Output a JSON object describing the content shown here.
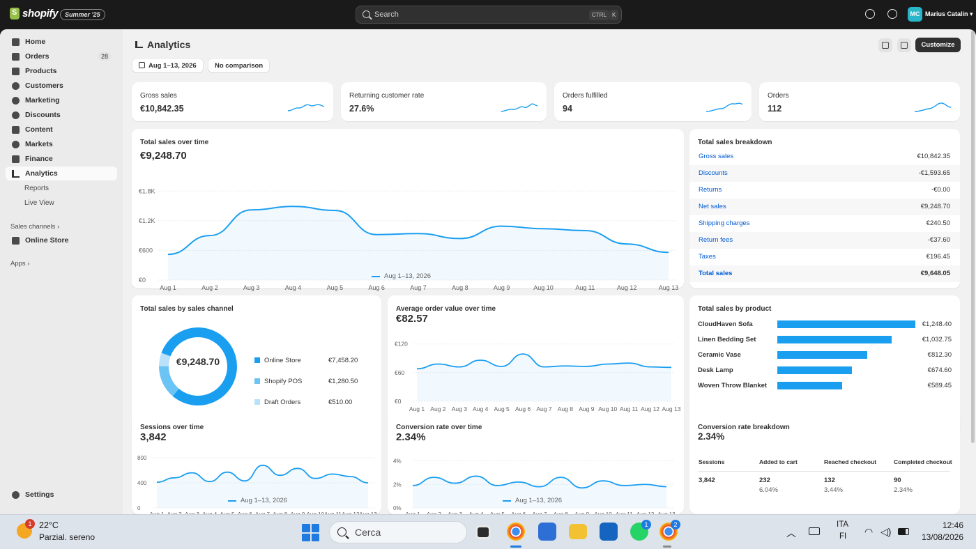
{
  "topbar": {
    "brand": "shopify",
    "edition": "Summer '25",
    "search_placeholder": "Search",
    "shortcut_ctrl": "CTRL",
    "shortcut_key": "K",
    "avatar_initials": "MC",
    "user_name": "Marius Catalin"
  },
  "sidebar": {
    "items": [
      {
        "label": "Home",
        "icon": "home-icon"
      },
      {
        "label": "Orders",
        "icon": "orders-icon",
        "count": "28"
      },
      {
        "label": "Products",
        "icon": "tag-icon"
      },
      {
        "label": "Customers",
        "icon": "person-icon"
      },
      {
        "label": "Marketing",
        "icon": "target-icon"
      },
      {
        "label": "Discounts",
        "icon": "discount-icon"
      },
      {
        "label": "Content",
        "icon": "content-icon"
      },
      {
        "label": "Markets",
        "icon": "globe-icon"
      },
      {
        "label": "Finance",
        "icon": "bank-icon"
      },
      {
        "label": "Analytics",
        "icon": "bar-chart-icon"
      }
    ],
    "sub_items": [
      "Reports",
      "Live View"
    ],
    "sales_channels": "Sales channels",
    "online_store": "Online Store",
    "apps": "Apps",
    "settings": "Settings"
  },
  "header": {
    "title": "Analytics",
    "date_range": "Aug 1–13, 2026",
    "comparison": "No comparison",
    "customize": "Customize"
  },
  "kpis": [
    {
      "label": "Gross sales",
      "value": "€10,842.35"
    },
    {
      "label": "Returning customer rate",
      "value": "27.6%"
    },
    {
      "label": "Orders fulfilled",
      "value": "94"
    },
    {
      "label": "Orders",
      "value": "112"
    }
  ],
  "days": [
    "Aug 1",
    "Aug 2",
    "Aug 3",
    "Aug 4",
    "Aug 5",
    "Aug 6",
    "Aug 7",
    "Aug 8",
    "Aug 9",
    "Aug 10",
    "Aug 11",
    "Aug 12",
    "Aug 13"
  ],
  "legend_label": "Aug 1–13, 2026",
  "total_sales": {
    "title": "Total sales over time",
    "value": "€9,248.70",
    "yticks": [
      "€1.8K",
      "€1.2K",
      "€600",
      "€0"
    ]
  },
  "breakdown": {
    "title": "Total sales breakdown",
    "rows": [
      {
        "label": "Gross sales",
        "value": "€10,842.35"
      },
      {
        "label": "Discounts",
        "value": "-€1,593.65"
      },
      {
        "label": "Returns",
        "value": "-€0.00"
      },
      {
        "label": "Net sales",
        "value": "€9,248.70"
      },
      {
        "label": "Shipping charges",
        "value": "€240.50"
      },
      {
        "label": "Return fees",
        "value": "-€37.60"
      },
      {
        "label": "Taxes",
        "value": "€196.45"
      },
      {
        "label": "Total sales",
        "value": "€9,648.05"
      }
    ]
  },
  "channel": {
    "title": "Total sales by sales channel",
    "center": "€9,248.70",
    "items": [
      {
        "label": "Online Store",
        "value": "€7,458.20",
        "color": "#1a9ef0"
      },
      {
        "label": "Shopify POS",
        "value": "€1,280.50",
        "color": "#6cc4f5"
      },
      {
        "label": "Draft Orders",
        "value": "€510.00",
        "color": "#b9e2fa"
      }
    ]
  },
  "aov": {
    "title": "Average order value over time",
    "value": "€82.57",
    "yticks": [
      "€120",
      "€60",
      "€0"
    ]
  },
  "products": {
    "title": "Total sales by product",
    "items": [
      {
        "label": "CloudHaven Sofa",
        "value": "€1,248.40",
        "amount": 1248.4
      },
      {
        "label": "Linen Bedding Set",
        "value": "€1,032.75",
        "amount": 1032.75
      },
      {
        "label": "Ceramic Vase",
        "value": "€812.30",
        "amount": 812.3
      },
      {
        "label": "Desk Lamp",
        "value": "€674.60",
        "amount": 674.6
      },
      {
        "label": "Woven Throw Blanket",
        "value": "€589.45",
        "amount": 589.45
      }
    ]
  },
  "sessions": {
    "title": "Sessions over time",
    "value": "3,842",
    "yticks": [
      "800",
      "400",
      "0"
    ]
  },
  "conversion": {
    "title": "Conversion rate over time",
    "value": "2.34%",
    "yticks": [
      "4%",
      "2%",
      "0%"
    ]
  },
  "funnel": {
    "title": "Conversion rate breakdown",
    "value": "2.34%",
    "cols": [
      {
        "label": "Sessions",
        "value": "3,842",
        "pct": ""
      },
      {
        "label": "Added to cart",
        "value": "232",
        "pct": "6.04%"
      },
      {
        "label": "Reached checkout",
        "value": "132",
        "pct": "3.44%"
      },
      {
        "label": "Completed checkout",
        "value": "90",
        "pct": "2.34%"
      }
    ]
  },
  "chart_data": [
    {
      "type": "line",
      "title": "Total sales over time",
      "categories": [
        "Aug 1",
        "Aug 2",
        "Aug 3",
        "Aug 4",
        "Aug 5",
        "Aug 6",
        "Aug 7",
        "Aug 8",
        "Aug 9",
        "Aug 10",
        "Aug 11",
        "Aug 12",
        "Aug 13"
      ],
      "series": [
        {
          "name": "Aug 1–13, 2026",
          "values": [
            520,
            900,
            1420,
            1490,
            1410,
            920,
            940,
            840,
            1090,
            1040,
            1000,
            730,
            560
          ]
        }
      ],
      "ylim": [
        0,
        2100
      ],
      "grid": true
    },
    {
      "type": "line",
      "title": "Average order value over time",
      "categories": [
        "Aug 1",
        "Aug 2",
        "Aug 3",
        "Aug 4",
        "Aug 5",
        "Aug 6",
        "Aug 7",
        "Aug 8",
        "Aug 9",
        "Aug 10",
        "Aug 11",
        "Aug 12",
        "Aug 13"
      ],
      "series": [
        {
          "name": "Aug 1–13, 2026",
          "values": [
            68,
            78,
            72,
            86,
            73,
            99,
            72,
            74,
            73,
            78,
            80,
            72,
            71
          ]
        }
      ],
      "ylim": [
        0,
        140
      ],
      "grid": true
    },
    {
      "type": "pie",
      "title": "Total sales by sales channel",
      "categories": [
        "Online Store",
        "Shopify POS",
        "Draft Orders"
      ],
      "values": [
        7458.2,
        1280.5,
        510.0
      ]
    },
    {
      "type": "bar",
      "title": "Total sales by product",
      "categories": [
        "CloudHaven Sofa",
        "Linen Bedding Set",
        "Ceramic Vase",
        "Desk Lamp",
        "Woven Throw Blanket"
      ],
      "values": [
        1248.4,
        1032.75,
        812.3,
        674.6,
        589.45
      ]
    },
    {
      "type": "line",
      "title": "Sessions over time",
      "categories": [
        "Aug 1",
        "Aug 2",
        "Aug 3",
        "Aug 4",
        "Aug 5",
        "Aug 6",
        "Aug 7",
        "Aug 8",
        "Aug 9",
        "Aug 10",
        "Aug 11",
        "Aug 12",
        "Aug 13"
      ],
      "series": [
        {
          "name": "Aug 1–13, 2026",
          "values": [
            410,
            480,
            560,
            420,
            570,
            430,
            680,
            520,
            630,
            470,
            540,
            500,
            400
          ]
        }
      ],
      "ylim": [
        0,
        900
      ],
      "grid": true
    },
    {
      "type": "line",
      "title": "Conversion rate over time",
      "categories": [
        "Aug 1",
        "Aug 2",
        "Aug 3",
        "Aug 4",
        "Aug 5",
        "Aug 6",
        "Aug 7",
        "Aug 8",
        "Aug 9",
        "Aug 10",
        "Aug 11",
        "Aug 12",
        "Aug 13"
      ],
      "series": [
        {
          "name": "Aug 1–13, 2026",
          "values": [
            1.9,
            2.6,
            2.1,
            2.7,
            1.9,
            2.2,
            1.8,
            2.6,
            1.7,
            2.3,
            1.9,
            2.0,
            1.8
          ]
        }
      ],
      "ylim": [
        0,
        4.8
      ],
      "grid": true
    }
  ],
  "taskbar": {
    "weather_badge": "1",
    "temperature": "22°C",
    "weather": "Parzial. sereno",
    "search": "Cerca",
    "whatsapp_badge": "1",
    "chrome_badge": "2",
    "lang": "ITA",
    "lang_sub": "FI",
    "time": "12:46",
    "date": "13/08/2026"
  }
}
